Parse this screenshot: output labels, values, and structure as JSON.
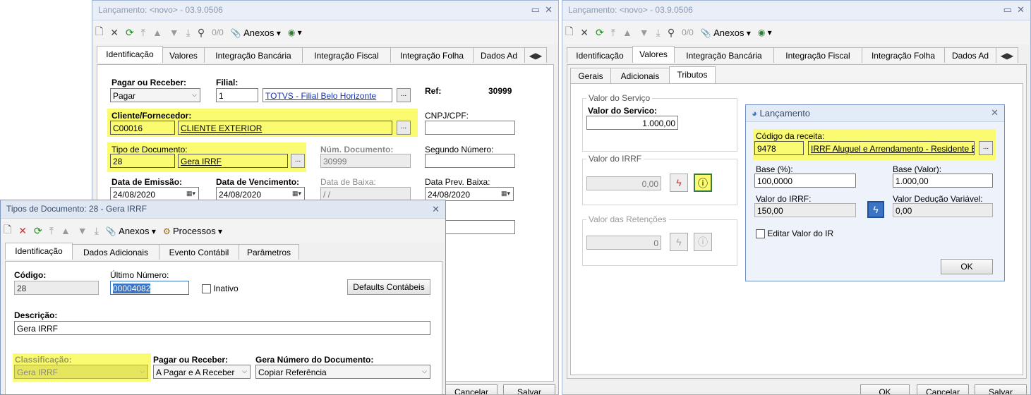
{
  "lanc1": {
    "title": "Lançamento: <novo> - 03.9.0506",
    "toolbar": {
      "counter": "0/0",
      "anexos": "Anexos"
    },
    "tabs": [
      "Identificação",
      "Valores",
      "Integração Bancária",
      "Integração Fiscal",
      "Integração Folha",
      "Dados Ad"
    ],
    "pagar_receber": {
      "label": "Pagar ou Receber:",
      "value": "Pagar"
    },
    "filial": {
      "label": "Filial:",
      "code": "1",
      "name": "TOTVS - Filial Belo Horizonte"
    },
    "ref": {
      "label": "Ref:",
      "value": "30999"
    },
    "cliente": {
      "label": "Cliente/Fornecedor:",
      "code": "C00016",
      "name": "CLIENTE EXTERIOR"
    },
    "cnpj": {
      "label": "CNPJ/CPF:",
      "value": ""
    },
    "tipo_doc": {
      "label": "Tipo de Documento:",
      "code": "28",
      "name": "Gera IRRF"
    },
    "num_doc": {
      "label": "Núm. Documento:",
      "value": "30999"
    },
    "segundo_numero": {
      "label": "Segundo Número:",
      "value": ""
    },
    "data_emissao": {
      "label": "Data de Emissão:",
      "value": "24/08/2020"
    },
    "data_vencimento": {
      "label": "Data de Vencimento:",
      "value": "24/08/2020"
    },
    "data_baixa": {
      "label": "Data de Baixa:",
      "value": " /  /"
    },
    "data_prev_baixa": {
      "label": "Data Prev. Baixa:",
      "value": "24/08/2020"
    },
    "buttons": {
      "cancelar": "Cancelar",
      "salvar": "Salvar"
    }
  },
  "tipos": {
    "title": "Tipos de Documento: 28 - Gera IRRF",
    "toolbar": {
      "anexos": "Anexos",
      "processos": "Processos"
    },
    "tabs": [
      "Identificação",
      "Dados Adicionais",
      "Evento Contábil",
      "Parâmetros"
    ],
    "codigo": {
      "label": "Código:",
      "value": "28"
    },
    "ultimo_numero": {
      "label": "Último Número:",
      "value": "00004082"
    },
    "inativo": "Inativo",
    "defaults_btn": "Defaults Contábeis",
    "descricao": {
      "label": "Descrição:",
      "value": "Gera IRRF"
    },
    "classificacao": {
      "label": "Classificação:",
      "value": "Gera IRRF"
    },
    "pagar_receber": {
      "label": "Pagar ou Receber:",
      "value": "A Pagar e A Receber"
    },
    "gera_numero": {
      "label": "Gera Número do Documento:",
      "value": "Copiar Referência"
    }
  },
  "lanc2": {
    "title": "Lançamento: <novo> - 03.9.0506",
    "toolbar": {
      "counter": "0/0",
      "anexos": "Anexos"
    },
    "tabs": [
      "Identificação",
      "Valores",
      "Integração Bancária",
      "Integração Fiscal",
      "Integração Folha",
      "Dados Ad"
    ],
    "subtabs": [
      "Gerais",
      "Adicionais",
      "Tributos"
    ],
    "valor_servico": {
      "group": "Valor do Serviço",
      "label": "Valor do Servico:",
      "value": "1.000,00"
    },
    "valor_irrf": {
      "group": "Valor do IRRF",
      "value": "0,00"
    },
    "valor_retencoes": {
      "group": "Valor das Retenções",
      "value": "0"
    },
    "buttons": {
      "ok": "OK",
      "cancelar": "Cancelar",
      "salvar": "Salvar"
    }
  },
  "dialog": {
    "title": "Lançamento",
    "codigo_receita": {
      "label": "Código da receita:",
      "code": "9478",
      "name": "IRRF Aluguel e Arrendamento - Residente Exterior"
    },
    "base_pct": {
      "label": "Base (%):",
      "value": "100,0000"
    },
    "base_valor": {
      "label": "Base (Valor):",
      "value": "1.000,00"
    },
    "valor_irrf": {
      "label": "Valor do IRRF:",
      "value": "150,00"
    },
    "valor_deducao": {
      "label": "Valor Dedução Variável:",
      "value": "0,00"
    },
    "editar": "Editar Valor do IR",
    "ok": "OK"
  }
}
